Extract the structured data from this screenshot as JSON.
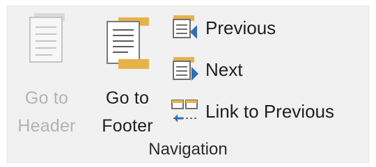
{
  "group": {
    "label": "Navigation"
  },
  "buttons": {
    "go_to_header": {
      "label": "Go to\nHeader",
      "enabled": false
    },
    "go_to_footer": {
      "label": "Go to\nFooter",
      "enabled": true
    },
    "previous": {
      "label": "Previous"
    },
    "next": {
      "label": "Next"
    },
    "link_to_previous": {
      "label": "Link to Previous"
    }
  },
  "icons": {
    "go_to_header": "page-with-header-band-icon",
    "go_to_footer": "page-with-footer-band-icon",
    "previous": "previous-section-icon",
    "next": "next-section-icon",
    "link_to_previous": "link-to-previous-icon"
  },
  "colors": {
    "accent_gold": "#e8b24a",
    "accent_blue": "#2f6fb5",
    "disabled_text": "#b3b3b3",
    "text": "#1f1f1f"
  }
}
